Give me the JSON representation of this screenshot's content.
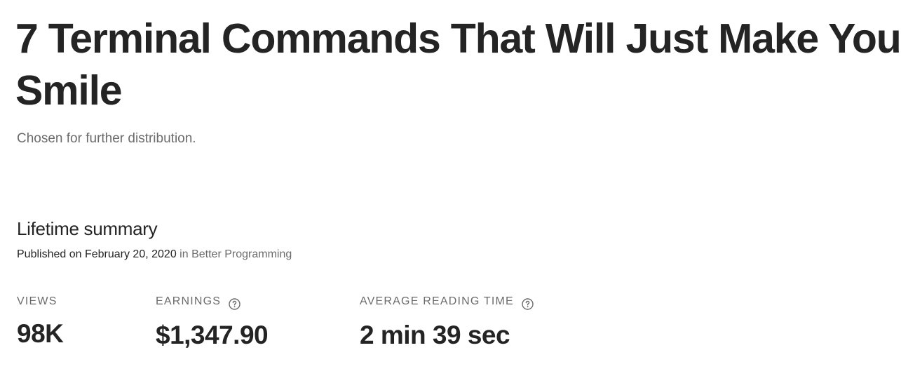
{
  "story": {
    "title": "7 Terminal Commands That Will Just Make You Smile",
    "distribution_note": "Chosen for further distribution."
  },
  "summary": {
    "heading": "Lifetime summary",
    "published_prefix": "Published on February 20, 2020",
    "published_in": "in",
    "publication": "Better Programming"
  },
  "stats": {
    "views": {
      "label": "VIEWS",
      "value": "98K"
    },
    "earnings": {
      "label": "EARNINGS",
      "value": "$1,347.90",
      "help_icon": "question-circle-icon"
    },
    "reading_time": {
      "label": "AVERAGE READING TIME",
      "value": "2 min 39 sec",
      "help_icon": "question-circle-icon"
    }
  },
  "colors": {
    "text_primary": "#242424",
    "text_secondary": "#6b6b6b",
    "background": "#ffffff"
  }
}
